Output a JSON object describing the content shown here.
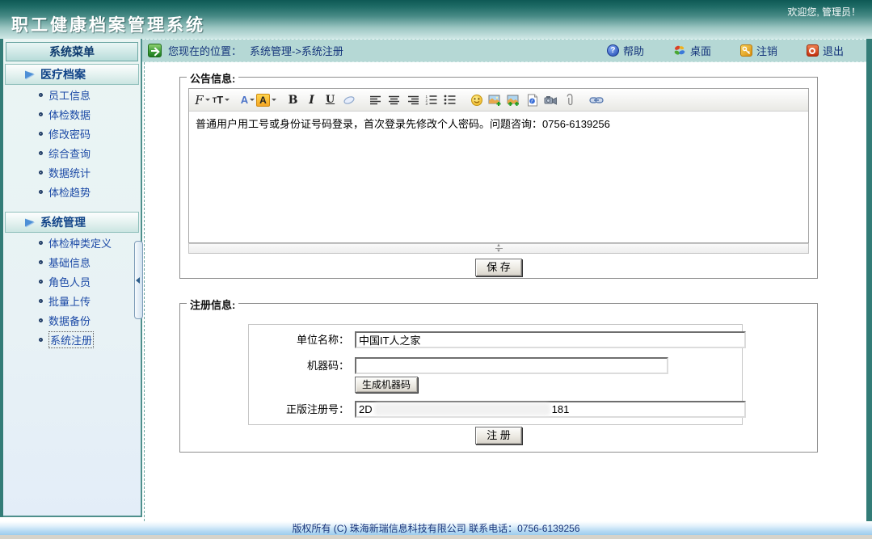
{
  "app": {
    "title": "职工健康档案管理系统",
    "welcome": "欢迎您, 管理员！"
  },
  "topnav": {
    "help": "帮助",
    "desktop": "桌面",
    "logout": "注销",
    "exit": "退出"
  },
  "breadcrumb": {
    "label": "您现在的位置：",
    "path": "系统管理->系统注册"
  },
  "sidebar": {
    "title": "系统菜单",
    "groups": [
      {
        "label": "医疗档案",
        "items": [
          "员工信息",
          "体检数据",
          "修改密码",
          "综合查询",
          "数据统计",
          "体检趋势"
        ]
      },
      {
        "label": "系统管理",
        "items": [
          "体检种类定义",
          "基础信息",
          "角色人员",
          "批量上传",
          "数据备份",
          "系统注册"
        ]
      }
    ],
    "active_item": "系统注册"
  },
  "notice": {
    "legend": "公告信息:",
    "content": "普通用户用工号或身份证号码登录，首次登录先修改个人密码。问题咨询：0756-6139256",
    "save_button": "保 存",
    "glyphs": {
      "font": "F",
      "size_small": "T",
      "size_big": "T",
      "color": "A",
      "highlight": "A",
      "bold": "B",
      "italic": "I",
      "underline": "U"
    },
    "toolbar_icons": [
      "font-family",
      "font-size",
      "font-color",
      "highlight-color",
      "bold",
      "italic",
      "underline",
      "eraser",
      "align-left",
      "align-center",
      "align-right",
      "ordered-list",
      "unordered-list",
      "emoticon",
      "insert-image",
      "insert-multi-image",
      "insert-flash",
      "insert-video",
      "attachment",
      "hyperlink"
    ]
  },
  "register": {
    "legend": "注册信息:",
    "unit_label": "单位名称：",
    "unit_value": "中国IT人之家",
    "machine_label": "机器码：",
    "machine_value": "",
    "generate_button": "生成机器码",
    "serial_label": "正版注册号：",
    "serial_prefix": "2D",
    "serial_suffix": "181",
    "serial_redacted": true,
    "register_button": "注 册"
  },
  "footer": {
    "copyright": "版权所有 (C) 珠海新瑞信息科技有限公司  联系电话：0756-6139256"
  },
  "colors": {
    "header_teal_dark": "#0e5955",
    "header_teal_light": "#cfe8e6",
    "breadcrumb_bg": "#b5d8d5",
    "nav_text": "#15357b",
    "sidebar_bg": "#eaf5f3",
    "menu_text": "#1c4aa6",
    "footer_blue": "#9cccee"
  }
}
